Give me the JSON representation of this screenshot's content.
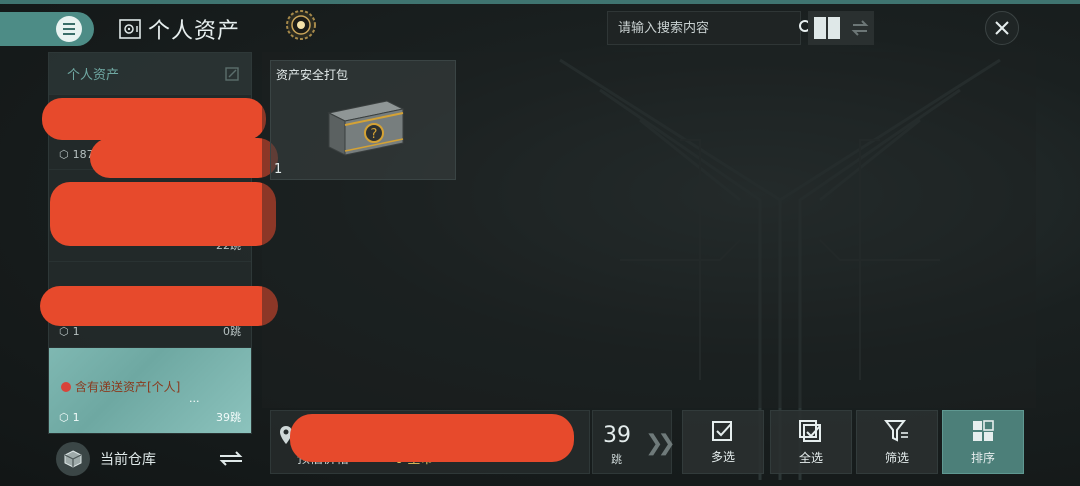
{
  "header": {
    "title": "个人资产",
    "search_placeholder": "请输入搜索内容"
  },
  "sidebar": {
    "header_label": "个人资产",
    "items": [
      {
        "count": "187",
        "jumps": ""
      },
      {
        "count": "",
        "jumps": "22跳"
      },
      {
        "count": "1",
        "jumps": "0跳"
      },
      {
        "name": "含有递送资产[个人]",
        "more": "...",
        "count": "1",
        "jumps": "39跳"
      }
    ],
    "warehouse_label": "当前仓库"
  },
  "items": [
    {
      "name": "资产安全打包",
      "quantity": "1"
    }
  ],
  "bottom": {
    "price_label": "预估价格",
    "price_value": "0 星币",
    "jumps": "39",
    "jumps_unit": "跳"
  },
  "actions": {
    "multi_select": "多选",
    "select_all": "全选",
    "filter": "筛选",
    "sort": "排序"
  },
  "colors": {
    "accent": "#4d8c86",
    "redaction": "#e74a2c",
    "price": "#e1c25c"
  }
}
